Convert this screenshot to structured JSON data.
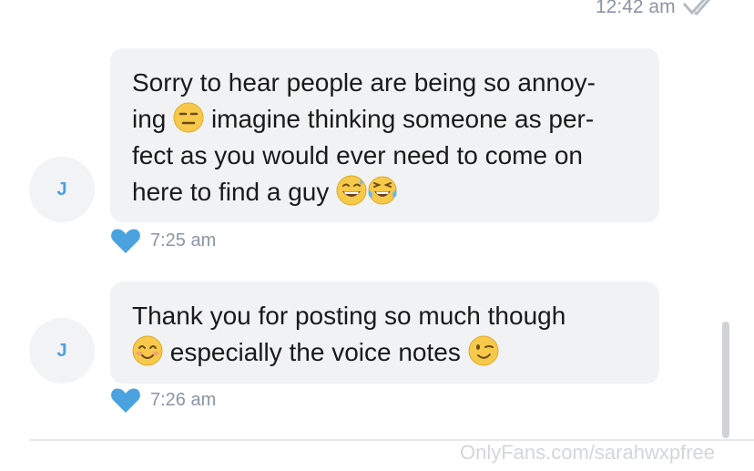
{
  "header": {
    "timestamp": "12:42 am",
    "read_icon": "double-check-icon"
  },
  "messages": [
    {
      "avatar_initial": "J",
      "lines": [
        {
          "text": "Sorry to hear people are being so annoy-"
        },
        {
          "pre": "ing",
          "emoji": "expressionless-face",
          "post": "imagine thinking someone as per-"
        },
        {
          "text": "fect as you would ever need to come on"
        },
        {
          "pre": "here to find a guy",
          "emoji": "grinning-sweat-face",
          "emoji2": "tears-of-joy-face"
        }
      ],
      "liked_icon": "heart-icon",
      "time": "7:25 am"
    },
    {
      "avatar_initial": "J",
      "lines": [
        {
          "text": "Thank you for posting so much though"
        },
        {
          "emoji": "smiling-face",
          "post": "especially the voice notes",
          "emoji2": "winking-face"
        }
      ],
      "liked_icon": "heart-icon",
      "time": "7:26 am"
    }
  ],
  "watermark": "OnlyFans.com/sarahwxpfree",
  "colors": {
    "bubble": "#f1f2f4",
    "heart": "#4aa3df",
    "muted_text": "#8a96a3",
    "avatar_bg": "#f2f3f5"
  }
}
